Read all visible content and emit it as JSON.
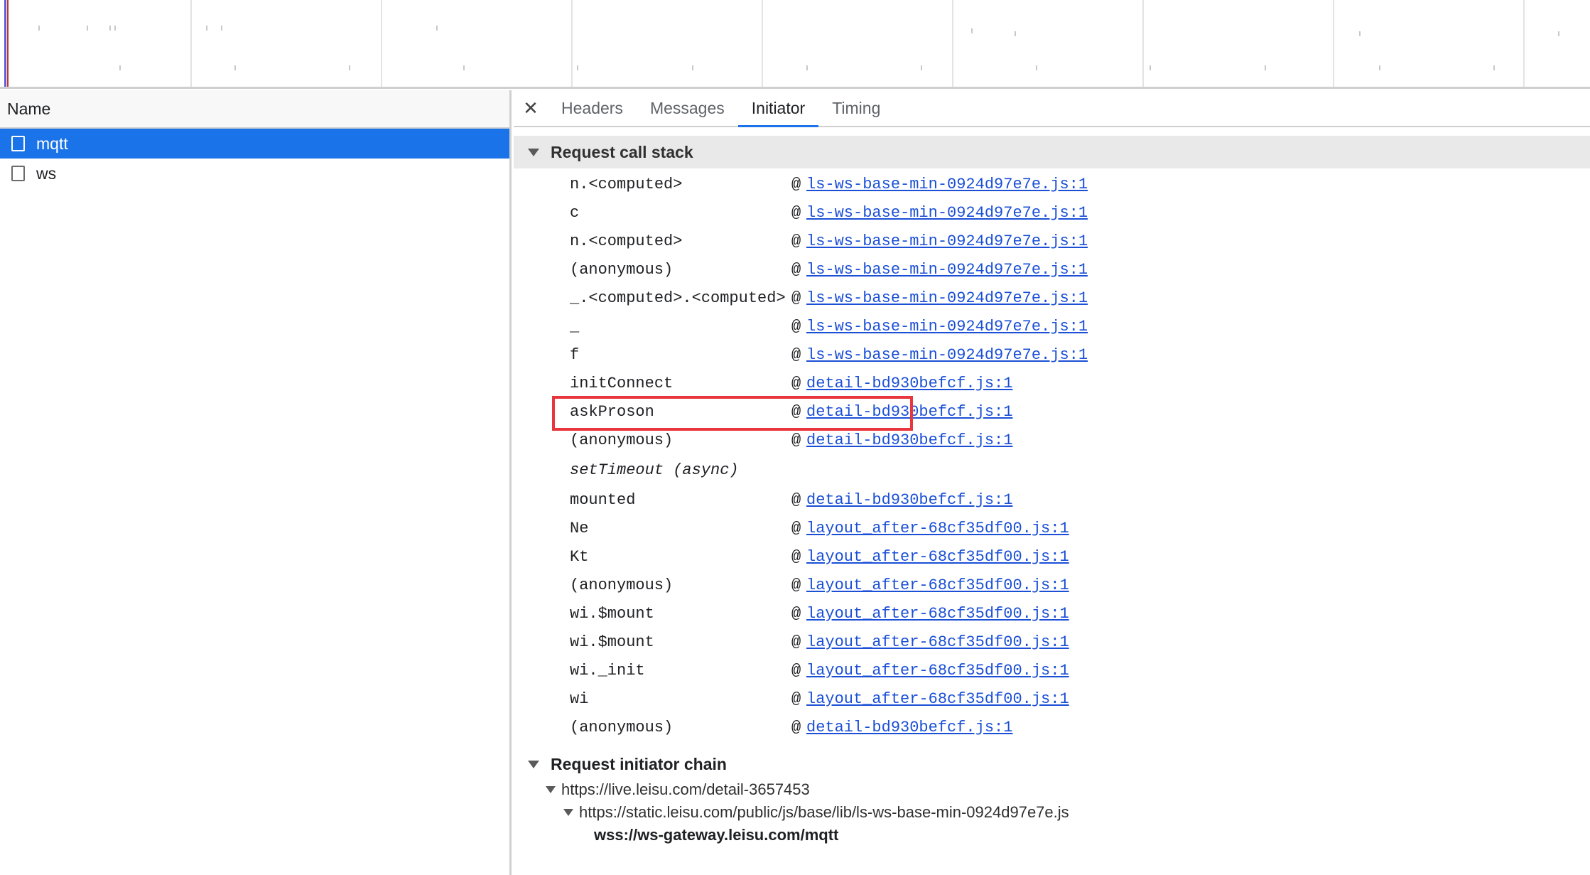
{
  "left_panel": {
    "column_header": "Name",
    "requests": [
      {
        "name": "mqtt",
        "selected": true
      },
      {
        "name": "ws",
        "selected": false
      }
    ]
  },
  "tabs": {
    "close_icon": "close-icon",
    "items": [
      {
        "label": "Headers",
        "active": false
      },
      {
        "label": "Messages",
        "active": false
      },
      {
        "label": "Initiator",
        "active": true
      },
      {
        "label": "Timing",
        "active": false
      }
    ]
  },
  "call_stack": {
    "title": "Request call stack",
    "at_symbol": "@",
    "frames": [
      {
        "fn": "n.<computed>",
        "link": "ls-ws-base-min-0924d97e7e.js:1"
      },
      {
        "fn": "c",
        "link": "ls-ws-base-min-0924d97e7e.js:1"
      },
      {
        "fn": "n.<computed>",
        "link": "ls-ws-base-min-0924d97e7e.js:1"
      },
      {
        "fn": "(anonymous)",
        "link": "ls-ws-base-min-0924d97e7e.js:1"
      },
      {
        "fn": "_.<computed>.<computed>",
        "link": "ls-ws-base-min-0924d97e7e.js:1"
      },
      {
        "fn": "_",
        "link": "ls-ws-base-min-0924d97e7e.js:1"
      },
      {
        "fn": "f",
        "link": "ls-ws-base-min-0924d97e7e.js:1"
      },
      {
        "fn": "initConnect",
        "link": "detail-bd930befcf.js:1",
        "highlighted": true
      },
      {
        "fn": "askProson",
        "link": "detail-bd930befcf.js:1"
      },
      {
        "fn": "(anonymous)",
        "link": "detail-bd930befcf.js:1"
      },
      {
        "fn": "setTimeout (async)",
        "link": "",
        "async": true
      },
      {
        "fn": "mounted",
        "link": "detail-bd930befcf.js:1"
      },
      {
        "fn": "Ne",
        "link": "layout_after-68cf35df00.js:1"
      },
      {
        "fn": "Kt",
        "link": "layout_after-68cf35df00.js:1"
      },
      {
        "fn": "(anonymous)",
        "link": "layout_after-68cf35df00.js:1"
      },
      {
        "fn": "wi.$mount",
        "link": "layout_after-68cf35df00.js:1"
      },
      {
        "fn": "wi.$mount",
        "link": "layout_after-68cf35df00.js:1"
      },
      {
        "fn": "wi._init",
        "link": "layout_after-68cf35df00.js:1"
      },
      {
        "fn": "wi",
        "link": "layout_after-68cf35df00.js:1"
      },
      {
        "fn": "(anonymous)",
        "link": "detail-bd930befcf.js:1"
      }
    ]
  },
  "initiator_chain": {
    "title": "Request initiator chain",
    "items": [
      {
        "level": 1,
        "text": "https://live.leisu.com/detail-3657453"
      },
      {
        "level": 2,
        "text": "https://static.leisu.com/public/js/base/lib/ls-ws-base-min-0924d97e7e.js"
      },
      {
        "level": 3,
        "text": "wss://ws-gateway.leisu.com/mqtt"
      }
    ]
  },
  "colors": {
    "selected_row": "#1a73e8",
    "link": "#1a4fd6",
    "highlight_box": "#e8363c"
  }
}
